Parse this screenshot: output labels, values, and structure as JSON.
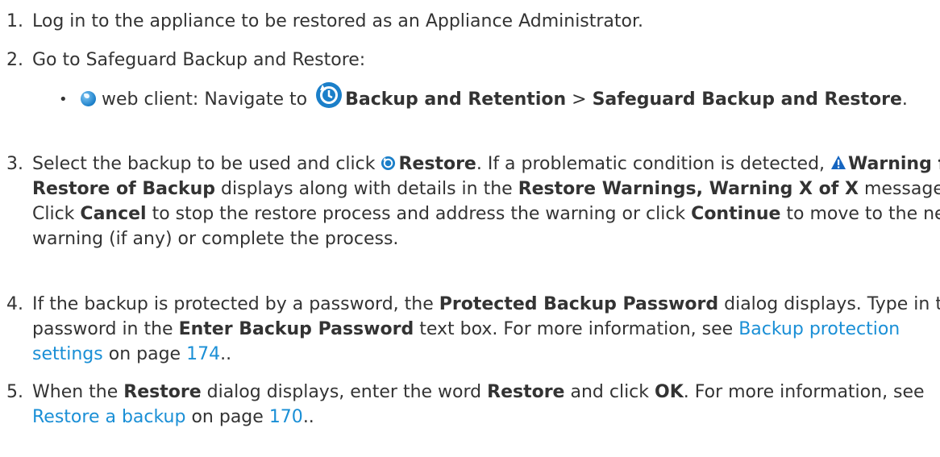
{
  "steps": [
    {
      "num": "1.",
      "text": "Log in to the appliance to be restored as an Appliance Administrator."
    },
    {
      "num": "2.",
      "text": "Go to Safeguard Backup and Restore:",
      "bullet": {
        "icon": "globe-icon",
        "pre": "web client: Navigate to ",
        "nav_icon": "restore-icon",
        "nav1": "Backup and Retention",
        "sep": " > ",
        "nav2": "Safeguard Backup and Restore",
        "post": "."
      }
    },
    {
      "num": "3.",
      "t1": "Select the backup to be used and click ",
      "b1": "Restore",
      "t2": ". If a problematic condition is detected, ",
      "b2": "Warning for Restore of Backup",
      "t3": " displays along with details in the ",
      "b3": "Restore Warnings, Warning X of X",
      "t4": " message. Click ",
      "b4": "Cancel",
      "t5": " to stop the restore process and address the warning or click ",
      "b5": "Continue",
      "t6": " to move to the next warning (if any) or complete the process."
    },
    {
      "num": "4.",
      "t1": "If the backup is protected by a password, the ",
      "b1": "Protected Backup Password",
      "t2": " dialog displays. Type in the password in the ",
      "b2": "Enter Backup Password",
      "t3": " text box. For more information, see ",
      "link": "Backup protection settings",
      "t4": " on page ",
      "page": "174",
      "t5": ".."
    },
    {
      "num": "5.",
      "t1": "When the ",
      "b1": "Restore",
      "t2": " dialog displays, enter the word ",
      "b2": "Restore",
      "t3": " and click ",
      "b3": "OK",
      "t4": ". For more information, see ",
      "link": "Restore a backup",
      "t5": " on page ",
      "page": "170",
      "t6": ".."
    }
  ],
  "bullet_char": "•",
  "colors": {
    "text": "#333333",
    "link": "#1a8fd6",
    "icon_blue": "#1b7fc9",
    "warning_blue": "#1565c0"
  }
}
